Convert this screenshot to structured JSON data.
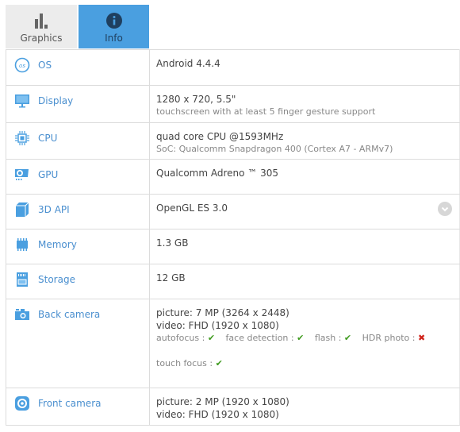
{
  "tabs": [
    {
      "label": "Graphics",
      "icon": "bar-chart-icon",
      "active": false
    },
    {
      "label": "Info",
      "icon": "info-icon",
      "active": true
    }
  ],
  "colors": {
    "accent": "#4a9fe0",
    "label": "#4a8fcf",
    "ok": "#3e9a1e",
    "no": "#d0231a"
  },
  "rows": [
    {
      "label": "OS",
      "icon": "os-icon",
      "value": "Android 4.4.4"
    },
    {
      "label": "Display",
      "icon": "monitor-icon",
      "value": "1280 x 720, 5.5\"",
      "sub": "touchscreen with at least 5 finger gesture support"
    },
    {
      "label": "CPU",
      "icon": "cpu-chip-icon",
      "value": "quad core CPU @1593MHz",
      "sub": "SoC: Qualcomm Snapdragon 400 (Cortex A7 - ARMv7)"
    },
    {
      "label": "GPU",
      "icon": "gpu-card-icon",
      "value": "Qualcomm Adreno ™ 305"
    },
    {
      "label": "3D API",
      "icon": "cube-icon",
      "value": "OpenGL ES 3.0",
      "expand_icon": "chevron-down-icon"
    },
    {
      "label": "Memory",
      "icon": "memory-icon",
      "value": "1.3 GB"
    },
    {
      "label": "Storage",
      "icon": "sd-card-icon",
      "value": "12 GB"
    },
    {
      "label": "Back camera",
      "icon": "camera-icon",
      "value": "picture: 7 MP (3264 x 2448)",
      "value2": "video: FHD (1920 x 1080)",
      "features": [
        {
          "name": "autofocus :",
          "supported": true
        },
        {
          "name": "face detection :",
          "supported": true
        },
        {
          "name": "flash :",
          "supported": true
        },
        {
          "name": "HDR photo :",
          "supported": false
        }
      ],
      "features2": [
        {
          "name": "touch focus :",
          "supported": true
        }
      ]
    },
    {
      "label": "Front camera",
      "icon": "front-camera-icon",
      "value": "picture: 2 MP (1920 x 1080)",
      "value2": "video: FHD (1920 x 1080)"
    }
  ],
  "glyphs": {
    "check": "✔",
    "cross": "✖"
  }
}
